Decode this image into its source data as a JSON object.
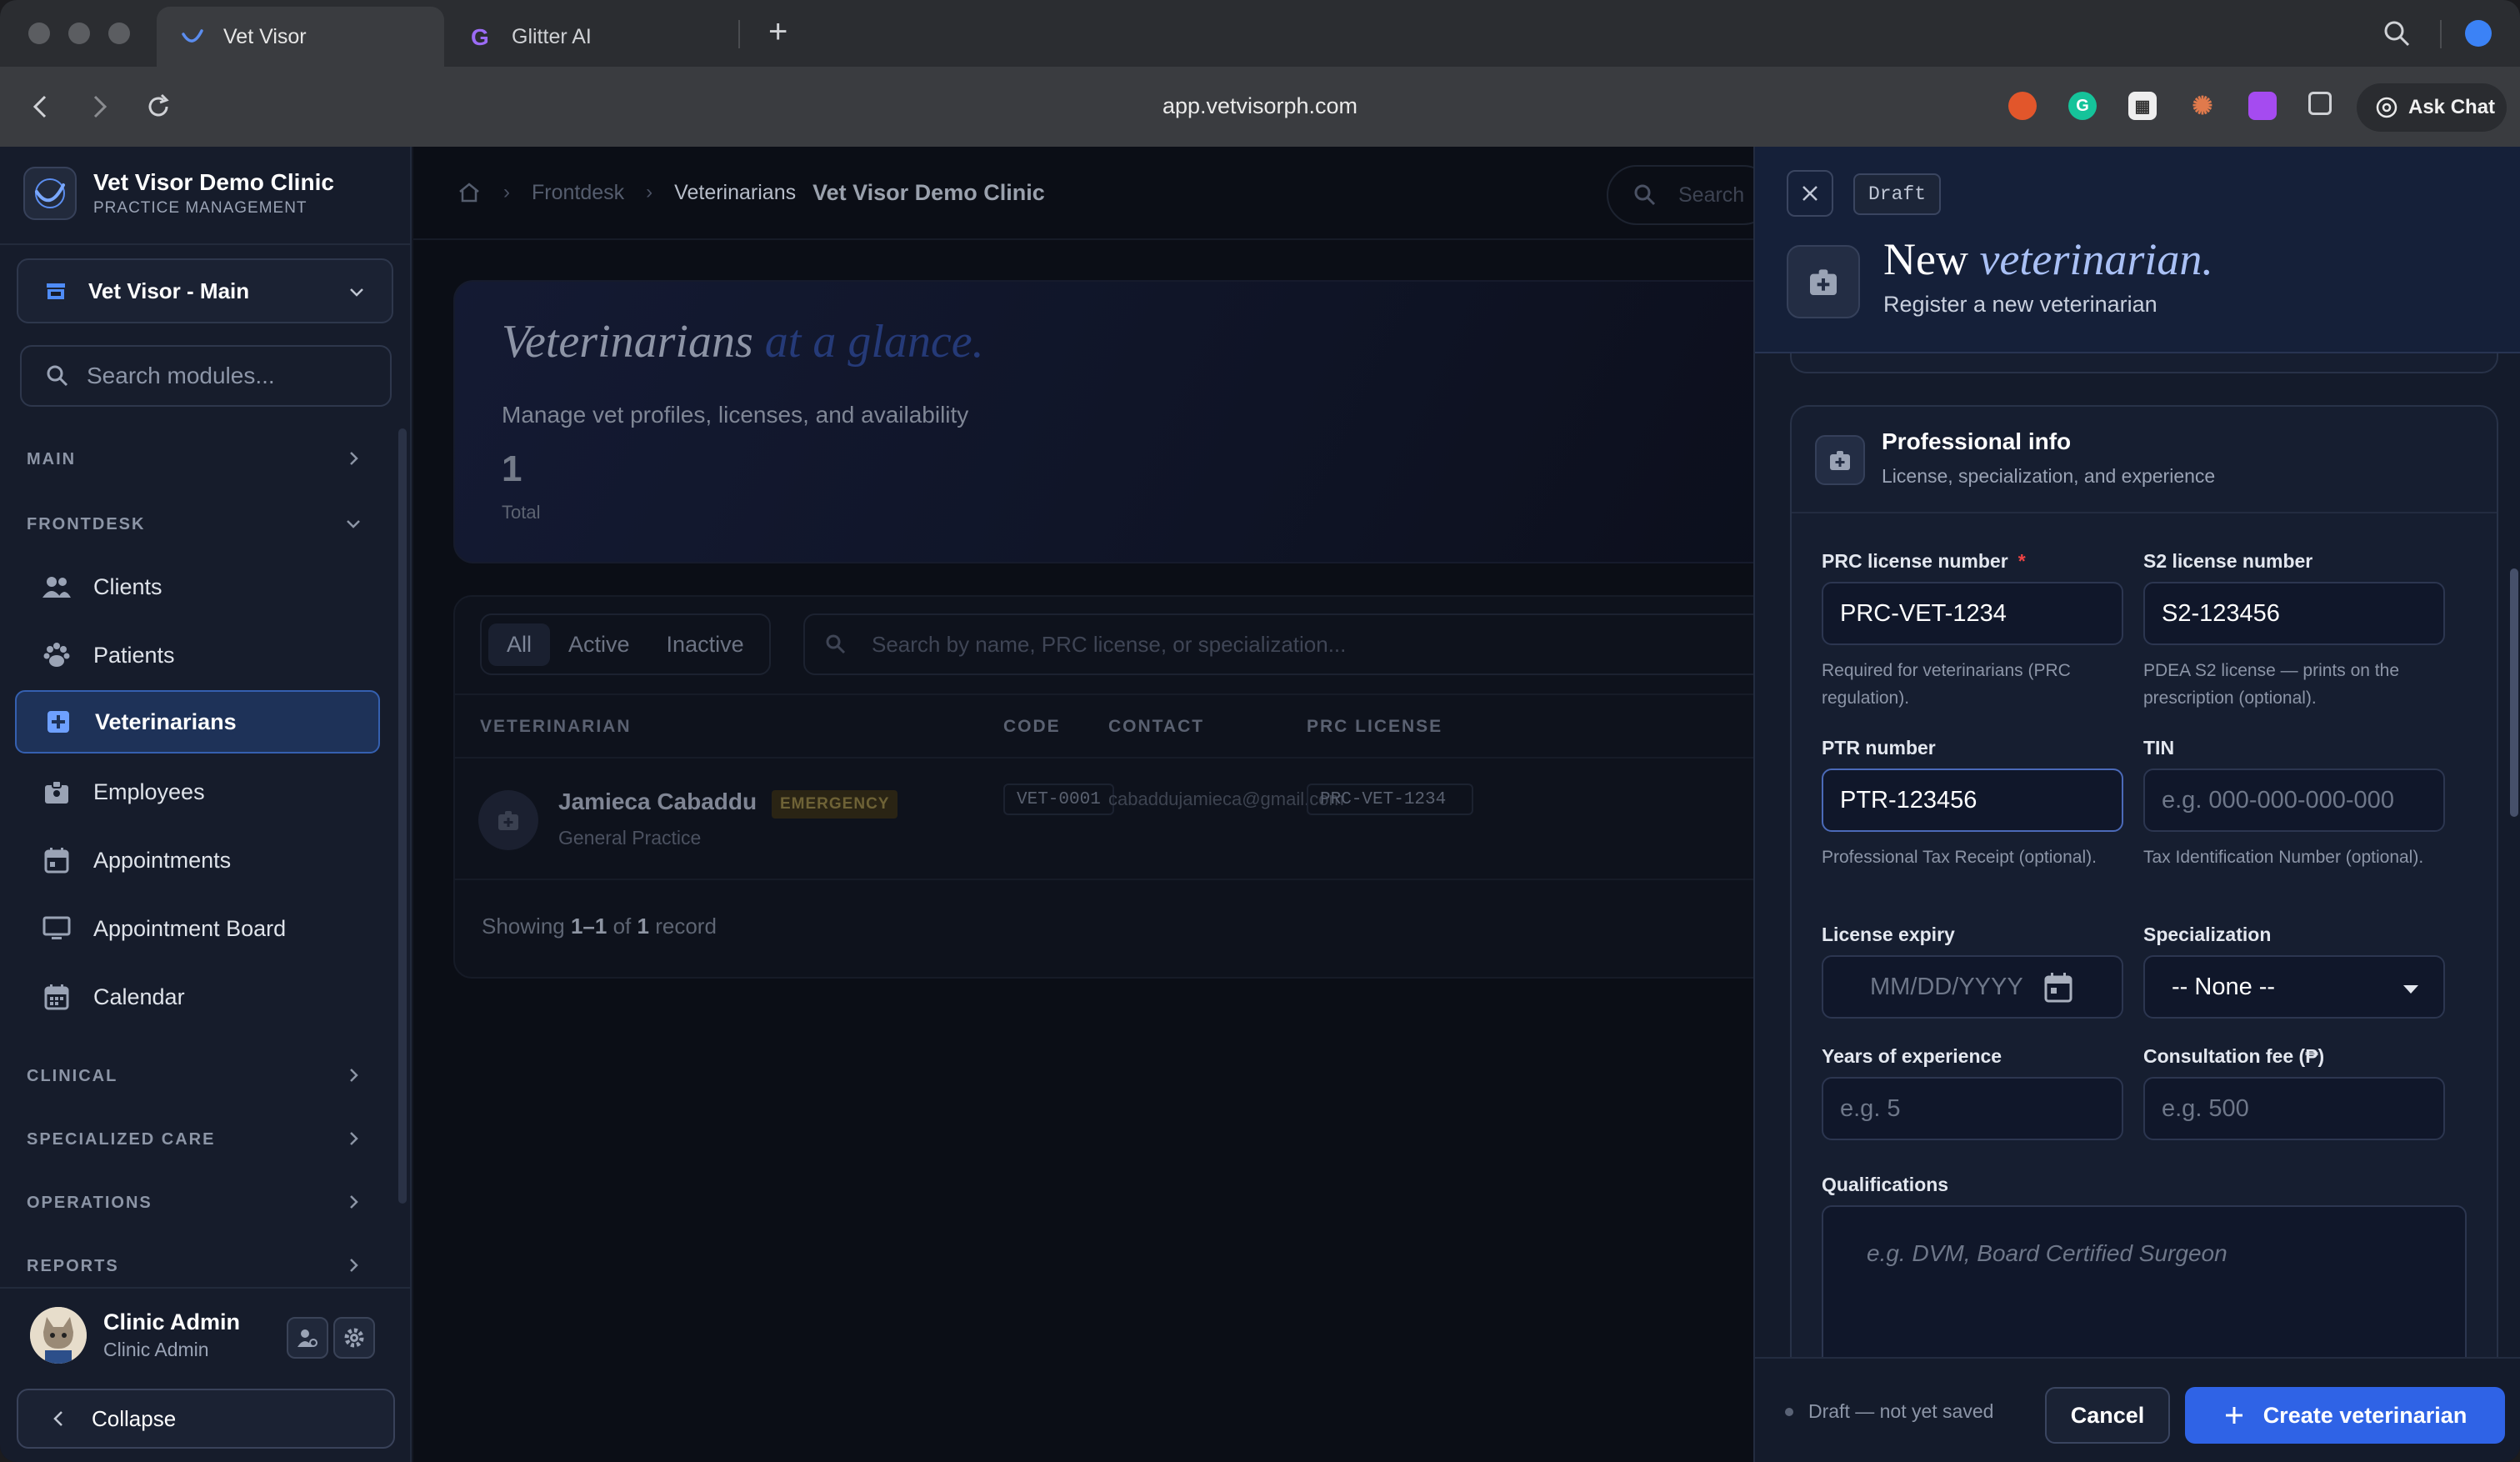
{
  "browser": {
    "tabs": [
      {
        "label": "Vet Visor"
      },
      {
        "label": "Glitter AI"
      }
    ],
    "url": "app.vetvisorph.com",
    "ask_chat": "Ask Chat"
  },
  "sidebar": {
    "brand_name": "Vet Visor Demo Clinic",
    "brand_sub": "PRACTICE MANAGEMENT",
    "branch": "Vet Visor - Main",
    "search_placeholder": "Search modules...",
    "sections": {
      "main": "MAIN",
      "frontdesk": "FRONTDESK",
      "clinical": "CLINICAL",
      "specialized": "SPECIALIZED CARE",
      "operations": "OPERATIONS",
      "reports": "REPORTS"
    },
    "items": [
      {
        "label": "Clients",
        "icon": "users-icon"
      },
      {
        "label": "Patients",
        "icon": "paw-icon"
      },
      {
        "label": "Veterinarians",
        "icon": "medical-plus-icon"
      },
      {
        "label": "Employees",
        "icon": "badge-icon"
      },
      {
        "label": "Appointments",
        "icon": "calendar-icon"
      },
      {
        "label": "Appointment Board",
        "icon": "monitor-icon"
      },
      {
        "label": "Calendar",
        "icon": "calendar-grid-icon"
      }
    ],
    "user": {
      "name": "Clinic Admin",
      "role": "Clinic Admin"
    },
    "collapse": "Collapse"
  },
  "main": {
    "breadcrumb": [
      "Frontdesk",
      "Veterinarians"
    ],
    "clinic": "Vet Visor Demo Clinic",
    "search_placeholder": "Search",
    "hero": {
      "title_a": "Veterinarians",
      "title_b": "at a glance.",
      "subtitle": "Manage vet profiles, licenses, and availability",
      "count": "1",
      "count_label": "Total"
    },
    "filters": [
      "All",
      "Active",
      "Inactive"
    ],
    "list_search_placeholder": "Search by name, PRC license, or specialization...",
    "columns": [
      "VETERINARIAN",
      "CODE",
      "CONTACT",
      "PRC LICENSE"
    ],
    "rows": [
      {
        "name": "Jamieca Cabaddu",
        "badge": "EMERGENCY",
        "spec": "General Practice",
        "code": "VET-0001",
        "contact": "cabaddujamieca@gmail.com",
        "prc": "PRC-VET-1234"
      }
    ],
    "showing": {
      "prefix": "Showing",
      "range": "1–1",
      "of": "of",
      "total": "1",
      "suffix": "record"
    }
  },
  "drawer": {
    "draft_tag": "Draft",
    "title_a": "New",
    "title_b": "veterinarian.",
    "subtitle": "Register a new veterinarian",
    "section_title": "Professional info",
    "section_sub": "License, specialization, and experience",
    "fields": {
      "prc": {
        "label": "PRC license number",
        "value": "PRC-VET-1234",
        "help": "Required for veterinarians (PRC regulation)."
      },
      "s2": {
        "label": "S2 license number",
        "value": "S2-123456",
        "help": "PDEA S2 license — prints on the prescription (optional)."
      },
      "ptr": {
        "label": "PTR number",
        "value": "PTR-123456",
        "help": "Professional Tax Receipt (optional)."
      },
      "tin": {
        "label": "TIN",
        "placeholder": "e.g. 000-000-000-000",
        "help": "Tax Identification Number (optional)."
      },
      "expiry": {
        "label": "License expiry",
        "placeholder": "MM/DD/YYYY"
      },
      "spec": {
        "label": "Specialization",
        "value": "-- None --"
      },
      "years": {
        "label": "Years of experience",
        "placeholder": "e.g. 5"
      },
      "fee": {
        "label": "Consultation fee (₱)",
        "placeholder": "e.g. 500"
      },
      "qual": {
        "label": "Qualifications",
        "placeholder": "e.g. DVM, Board Certified Surgeon"
      }
    },
    "footer": {
      "status": "Draft — not yet saved",
      "cancel": "Cancel",
      "create": "Create veterinarian"
    }
  },
  "colors": {
    "accent": "#2f63e6",
    "required": "#ef4444",
    "active_nav": "#1e3258"
  }
}
